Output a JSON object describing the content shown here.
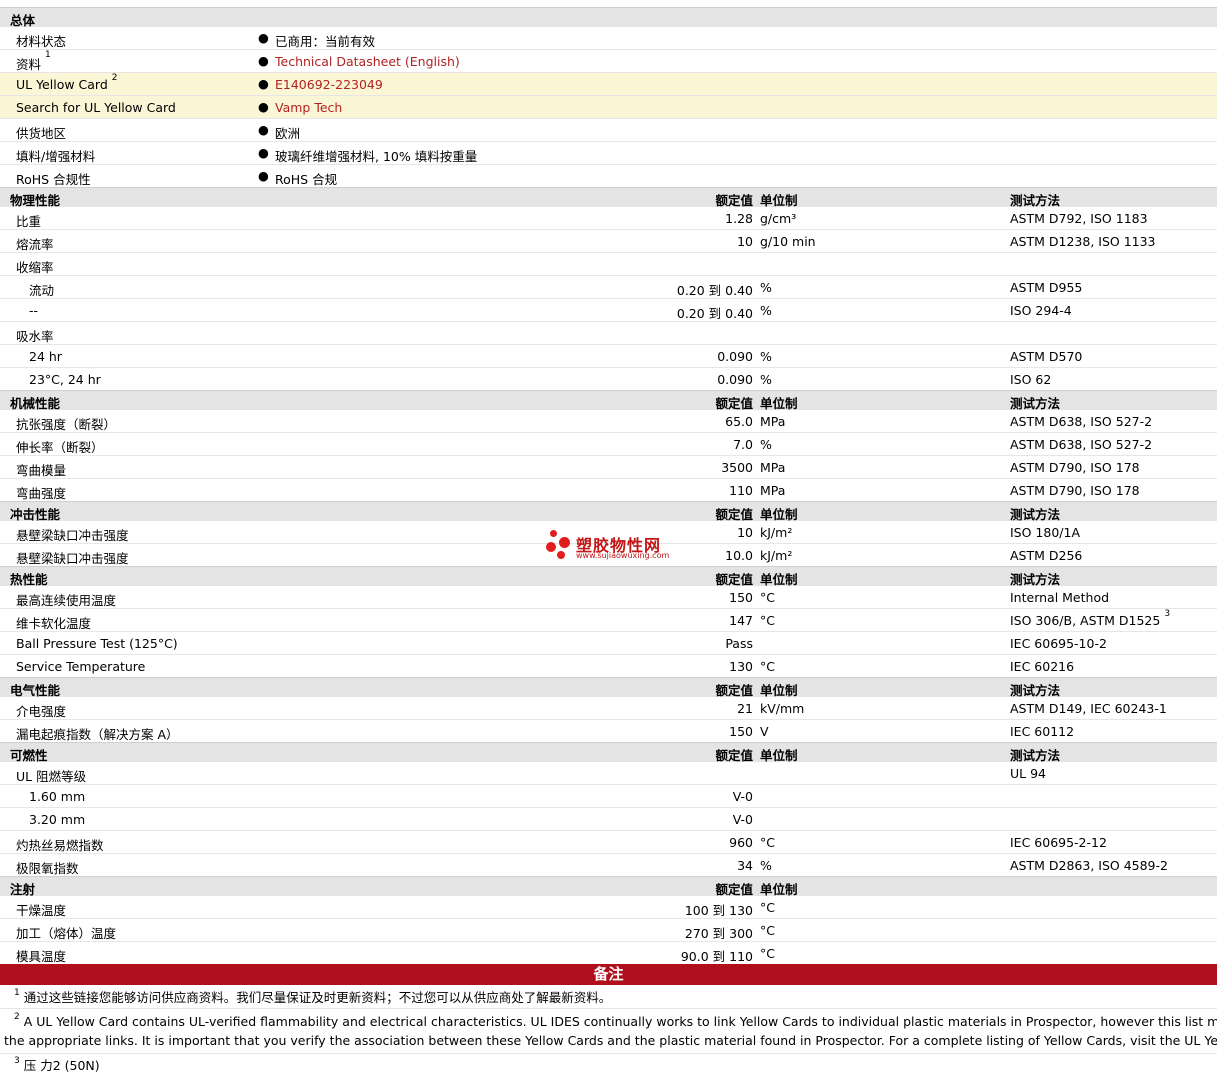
{
  "general": {
    "header": "总体",
    "rows": [
      {
        "label": "材料状态",
        "value": "已商用：当前有效"
      },
      {
        "label": "资料",
        "sup": "1",
        "value": "Technical Datasheet (English)"
      },
      {
        "label": "UL Yellow Card",
        "sup": "2",
        "value": "E140692-223049"
      },
      {
        "label": "Search for UL Yellow Card",
        "value": "Vamp Tech"
      },
      {
        "label": "供货地区",
        "value": "欧洲"
      },
      {
        "label": "填料/增强材料",
        "value": "玻璃纤维增强材料, 10% 填料按重量"
      },
      {
        "label": "RoHS 合规性",
        "value": "RoHS 合规"
      }
    ]
  },
  "columns": {
    "nominal": "额定值",
    "unit": "单位制",
    "method": "测试方法"
  },
  "physical": {
    "header": "物理性能",
    "rows": [
      {
        "label": "比重",
        "num": "1.28",
        "unit": "g/cm³",
        "method": "ASTM D792, ISO 1183"
      },
      {
        "label": "熔流率",
        "num": "10",
        "unit": "g/10 min",
        "method": "ASTM D1238, ISO 1133"
      },
      {
        "label": "收缩率"
      },
      {
        "label": "流动",
        "num": "0.20 到  0.40",
        "unit": "%",
        "method": "ASTM D955"
      },
      {
        "label": "--",
        "num": "0.20 到  0.40",
        "unit": "%",
        "method": "ISO 294-4"
      },
      {
        "label": "吸水率"
      },
      {
        "label": "24 hr",
        "num": "0.090",
        "unit": "%",
        "method": "ASTM D570"
      },
      {
        "label": "23°C, 24 hr",
        "num": "0.090",
        "unit": "%",
        "method": "ISO 62"
      }
    ]
  },
  "mechanical": {
    "header": "机械性能",
    "rows": [
      {
        "label": "抗张强度（断裂）",
        "num": "65.0",
        "unit": "MPa",
        "method": "ASTM D638, ISO 527-2"
      },
      {
        "label": "伸长率（断裂）",
        "num": "7.0",
        "unit": "%",
        "method": "ASTM D638, ISO 527-2"
      },
      {
        "label": "弯曲模量",
        "num": "3500",
        "unit": "MPa",
        "method": "ASTM D790, ISO 178"
      },
      {
        "label": "弯曲强度",
        "num": "110",
        "unit": "MPa",
        "method": "ASTM D790, ISO 178"
      }
    ]
  },
  "impact": {
    "header": "冲击性能",
    "rows": [
      {
        "label": "悬壁梁缺口冲击强度",
        "num": "10",
        "unit": "kJ/m²",
        "method": "ISO 180/1A"
      },
      {
        "label": "悬壁梁缺口冲击强度",
        "num": "10.0",
        "unit": "kJ/m²",
        "method": "ASTM D256"
      }
    ]
  },
  "thermal": {
    "header": "热性能",
    "rows": [
      {
        "label": "最高连续使用温度",
        "num": "150",
        "unit": "°C",
        "method": "Internal Method"
      },
      {
        "label": "维卡软化温度",
        "num": "147",
        "unit": "°C",
        "method": "ISO 306/B, ASTM D1525",
        "msup": "3"
      },
      {
        "label": "Ball Pressure Test (125°C)",
        "num": "Pass",
        "unit": "",
        "method": "IEC 60695-10-2"
      },
      {
        "label": "Service Temperature",
        "num": "130",
        "unit": "°C",
        "method": "IEC 60216"
      }
    ]
  },
  "electrical": {
    "header": "电气性能",
    "rows": [
      {
        "label": "介电强度",
        "num": "21",
        "unit": "kV/mm",
        "method": "ASTM D149, IEC 60243-1"
      },
      {
        "label": "漏电起痕指数（解决方案  A）",
        "num": "150",
        "unit": "V",
        "method": "IEC 60112"
      }
    ]
  },
  "flammability": {
    "header": "可燃性",
    "rows": [
      {
        "label": "UL 阻燃等级",
        "method": "UL 94"
      },
      {
        "label": "1.60 mm",
        "num": "V-0"
      },
      {
        "label": "3.20 mm",
        "num": "V-0"
      },
      {
        "label": "灼热丝易燃指数",
        "num": "960",
        "unit": "°C",
        "method": "IEC 60695-2-12"
      },
      {
        "label": "极限氧指数",
        "num": "34",
        "unit": "%",
        "method": "ASTM D2863, ISO 4589-2"
      }
    ]
  },
  "injection": {
    "header": "注射",
    "rows": [
      {
        "label": "干燥温度",
        "num": "100 到  130",
        "unit": "°C"
      },
      {
        "label": "加工（熔体）温度",
        "num": "270 到  300",
        "unit": "°C"
      },
      {
        "label": "模具温度",
        "num": "90.0 到  110",
        "unit": "°C"
      }
    ]
  },
  "notes": {
    "title": "备注",
    "n1_sup": "1",
    "n1": "通过这些链接您能够访问供应商资料。我们尽量保证及时更新资料；不过您可以从供应商处了解最新资料。",
    "n2_sup": "2",
    "n2a": "A UL Yellow Card contains UL-verified flammability and electrical characteristics. UL IDES continually works to link Yellow Cards to individual plastic materials in Prospector, however this list may not include all of",
    "n2b": "the appropriate links. It is important that you verify the association between these Yellow Cards and the plastic material found in Prospector. For a complete listing of Yellow Cards, visit the UL Yellow Card Search.",
    "n3_sup": "3",
    "n3": "压  力2 (50N)"
  },
  "watermark": {
    "title": "塑胶物性网",
    "url": "www.sujiaowuxing.com"
  }
}
